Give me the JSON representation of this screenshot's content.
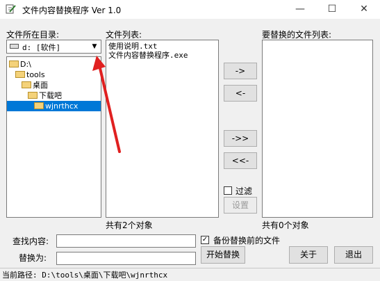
{
  "window": {
    "title": "文件内容替换程序 Ver 1.0"
  },
  "left": {
    "label": "文件所在目录:",
    "drive": "d: [软件]",
    "tree": [
      {
        "label": "D:\\",
        "level": 0,
        "selected": false
      },
      {
        "label": "tools",
        "level": 1,
        "selected": false
      },
      {
        "label": "桌面",
        "level": 2,
        "selected": false
      },
      {
        "label": "下载吧",
        "level": 3,
        "selected": false
      },
      {
        "label": "wjnrthcx",
        "level": 4,
        "selected": true
      }
    ]
  },
  "middle": {
    "label": "文件列表:",
    "files": [
      "使用说明.txt",
      "文件内容替换程序.exe"
    ],
    "count": "共有2个对象"
  },
  "right": {
    "label": "要替换的文件列表:",
    "count": "共有0个对象"
  },
  "buttons": {
    "add": "->",
    "remove": "<-",
    "add_all": "->>",
    "remove_all": "<<-",
    "filter": "过滤",
    "settings": "设置",
    "start": "开始替换",
    "about": "关于",
    "exit": "退出"
  },
  "form": {
    "find_label": "查找内容:",
    "replace_label": "替换为:",
    "find_value": "",
    "replace_value": "",
    "backup_label": "备份替换前的文件",
    "backup_checked": true,
    "filter_checked": false
  },
  "status": {
    "path": "当前路径: D:\\tools\\桌面\\下载吧\\wjnrthcx"
  }
}
